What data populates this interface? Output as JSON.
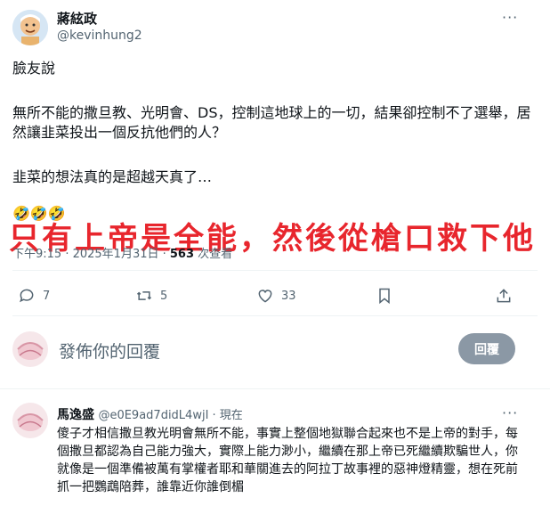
{
  "main_post": {
    "author_name": "蔣絃政",
    "author_handle": "@kevinhung2",
    "para1": "臉友說",
    "para2": "無所不能的撒旦教、光明會、DS，控制這地球上的一切，結果卻控制不了選舉，居然讓韭菜投出一個反抗他們的人？",
    "para3": "韭菜的想法真的是超越天真了…",
    "emojis": "🤣🤣🤣",
    "overlay_text": "只有上帝是全能，然後從槍口救下他",
    "time": "下午9:15 · 2025年1月31日 · ",
    "views_count": "563",
    "views_label": " 次查看",
    "more": "···"
  },
  "actions": {
    "reply_count": "7",
    "retweet_count": "5",
    "like_count": "33"
  },
  "composer": {
    "placeholder": "發佈你的回覆",
    "button_label": "回覆"
  },
  "reply": {
    "author_name": "馬逸盛",
    "author_handle": "@e0E9ad7didL4wjI",
    "time": " · 現在",
    "more": "···",
    "text": "傻子才相信撒旦教光明會無所不能，事實上整個地獄聯合起來也不是上帝的對手，每個撒旦都認為自己能力強大，實際上能力渺小，繼續在那上帝已死繼續欺騙世人，你就像是一個準備被萬有掌權者耶和華關進去的阿拉丁故事裡的惡神燈精靈，想在死前抓一把鸚鵡陪葬，誰靠近你誰倒楣"
  },
  "colors": {
    "overlay_red": "#e8262d",
    "secondary_text": "#536471",
    "divider": "#eff3f4"
  }
}
